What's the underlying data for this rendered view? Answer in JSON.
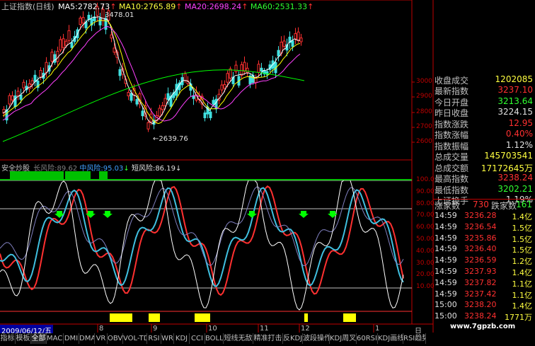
{
  "header": {
    "title": "上证指数(日线)",
    "ma5": "MA5:2782.73",
    "ma10": "MA10:2765.89",
    "ma20": "MA20:2698.24",
    "ma60": "MA60:2531.33",
    "arrow": "↑"
  },
  "price_annotations": {
    "high": "3478.01",
    "low": "←2639.76"
  },
  "price_axis": [
    "3000",
    "2900",
    "2800",
    "2700",
    "2600"
  ],
  "indicator_header": {
    "name": "安全炒股",
    "long_risk": "长风险:89.62",
    "mid_risk": "中风险:95.03",
    "short_risk": "短风险:86.19",
    "arrow": "↓"
  },
  "indicator_axis": [
    "100.0",
    "90.00",
    "80.00",
    "70.00",
    "60.00",
    "50.00",
    "40.00",
    "30.00",
    "20.00",
    "10.00"
  ],
  "quote_panel": {
    "top_cut": "收盘成交",
    "top_cut_value": "1202085",
    "rows": [
      {
        "label": "最新指数",
        "value": "3237.10",
        "color": "#ff3030"
      },
      {
        "label": "今日开盘",
        "value": "3213.64",
        "color": "#30ff30"
      },
      {
        "label": "昨日收盘",
        "value": "3224.15",
        "color": "#e0e0e0"
      },
      {
        "label": "指数涨跌",
        "value": "12.95",
        "color": "#ff3030"
      },
      {
        "label": "指数涨幅",
        "value": "0.40%",
        "color": "#ff3030"
      },
      {
        "label": "指数振幅",
        "value": "1.12%",
        "color": "#e0e0e0"
      },
      {
        "label": "总成交量",
        "value": "145703541",
        "color": "#ffff40"
      },
      {
        "label": "总成交额",
        "value": "17172645万",
        "color": "#ffff40"
      },
      {
        "label": "最高指数",
        "value": "3238.24",
        "color": "#ff3030"
      },
      {
        "label": "最低指数",
        "value": "3202.21",
        "color": "#30ff30"
      },
      {
        "label": "上证换手",
        "value": "1.19%",
        "color": "#e0e0e0"
      }
    ],
    "up_label": "涨家数",
    "up_value": "730",
    "down_label": "跌家数",
    "down_value": "161"
  },
  "ticks": [
    {
      "time": "14:59",
      "price": "3236.28",
      "vol": "1.4亿"
    },
    {
      "time": "14:59",
      "price": "3236.54",
      "vol": "1.5亿"
    },
    {
      "time": "14:59",
      "price": "3235.86",
      "vol": "1.5亿"
    },
    {
      "time": "14:59",
      "price": "3236.40",
      "vol": "1.5亿"
    },
    {
      "time": "14:59",
      "price": "3236.59",
      "vol": "1.2亿"
    },
    {
      "time": "14:59",
      "price": "3237.93",
      "vol": "1.4亿"
    },
    {
      "time": "14:59",
      "price": "3237.82",
      "vol": "1.1亿"
    },
    {
      "time": "14:59",
      "price": "3237.42",
      "vol": "1.1亿"
    },
    {
      "time": "15:00",
      "price": "3238.20",
      "vol": "1.4亿"
    },
    {
      "time": "15:00",
      "price": "3238.24",
      "vol": "1771万"
    }
  ],
  "timeline": {
    "date": "2009/06/12/五",
    "months": [
      "8",
      "9",
      "10",
      "11",
      "12",
      "1"
    ],
    "period": "日线"
  },
  "tabs": [
    "指标",
    "模板",
    "全部",
    "MACD",
    "DMI",
    "DMA",
    "VR",
    "OBV",
    "VOL-TDX",
    "RSI",
    "WR",
    "KDJ",
    "CCI",
    "BOLL",
    "短线无敌",
    "精准打击",
    "反KDJ",
    "波段操作",
    "KDJ周叉",
    "60RSI",
    "KDJ画线",
    "RSI趋势"
  ],
  "watermark": "www.7gpzb.com",
  "colors": {
    "up": "#ff3030",
    "down": "#40e0e0",
    "ma5": "#ffffff",
    "ma10": "#ffff00",
    "ma20": "#ff40ff",
    "ma60": "#00ff00"
  }
}
